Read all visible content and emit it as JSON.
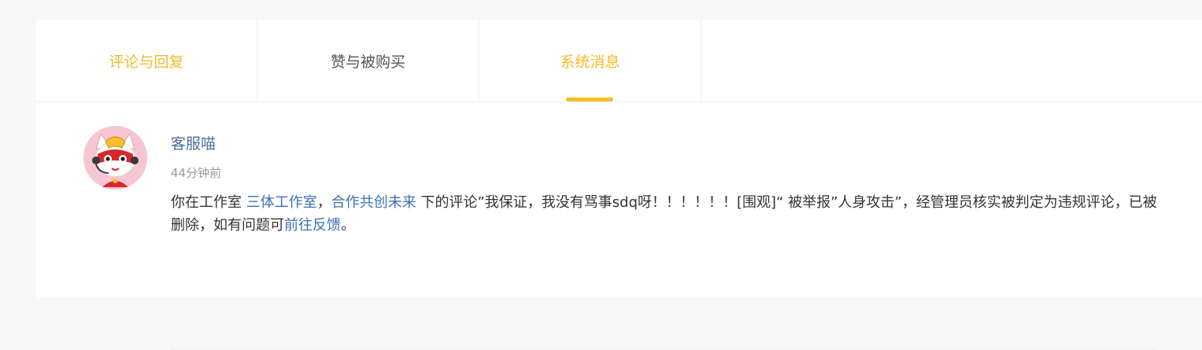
{
  "tabs": [
    {
      "label": "评论与回复"
    },
    {
      "label": "赞与被购买"
    },
    {
      "label": "系统消息"
    }
  ],
  "message": {
    "sender": "客服喵",
    "time": "44分钟前",
    "text_prefix": "你在工作室 ",
    "studio_link": "三体工作室",
    "comma": "，",
    "project_link": "合作共创未来",
    "text_mid": " 下的评论”我保证，我没有骂事sdq呀！！！！！！[围观]“ 被举报”人身攻击”，经管理员核实被判定为违规评论，已被删除，如有问题可",
    "feedback_link": "前往反馈",
    "text_end": "。"
  },
  "colors": {
    "accent": "#f2bb2a",
    "link": "#3d6fb6",
    "sender": "#4f6f9a"
  },
  "icons": {
    "avatar": "cat-mascot-avatar"
  }
}
